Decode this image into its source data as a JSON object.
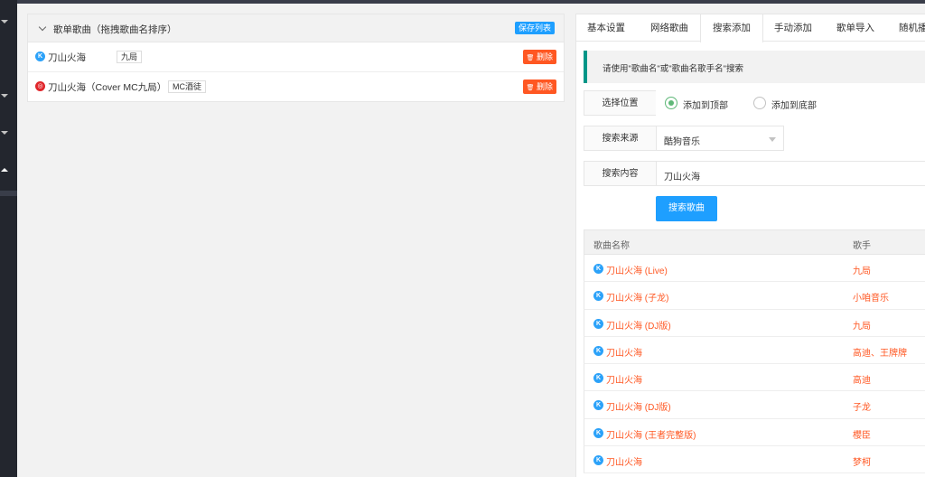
{
  "playlist": {
    "title": "歌单歌曲（拖拽歌曲名排序）",
    "save_label": "保存列表",
    "songs": [
      {
        "name": "刀山火海",
        "tag": "九局",
        "source": "kugou",
        "delete_label": "删除"
      },
      {
        "name": "刀山火海（Cover MC九局）",
        "tag": "MC酒徒",
        "source": "netease",
        "delete_label": "删除"
      }
    ]
  },
  "tabs": [
    "基本设置",
    "网络歌曲",
    "搜索添加",
    "手动添加",
    "歌单导入",
    "随机播"
  ],
  "active_tab": "搜索添加",
  "notice": "请使用\"歌曲名\"或\"歌曲名歌手名\"搜索",
  "form": {
    "position_label": "选择位置",
    "position_options": [
      "添加到顶部",
      "添加到底部"
    ],
    "position_selected": "添加到顶部",
    "source_label": "搜索来源",
    "source_value": "酷狗音乐",
    "content_label": "搜索内容",
    "content_value": "刀山火海",
    "search_button": "搜索歌曲"
  },
  "results": {
    "headers": [
      "歌曲名称",
      "歌手"
    ],
    "rows": [
      {
        "name": "刀山火海 (Live)",
        "singer": "九局"
      },
      {
        "name": "刀山火海 (子龙)",
        "singer": "小咱音乐"
      },
      {
        "name": "刀山火海 (DJ版)",
        "singer": "九局"
      },
      {
        "name": "刀山火海",
        "singer": "高迪、王牌牌"
      },
      {
        "name": "刀山火海",
        "singer": "高迪"
      },
      {
        "name": "刀山火海 (DJ版)",
        "singer": "子龙"
      },
      {
        "name": "刀山火海 (王者完整版)",
        "singer": "櫻臣"
      },
      {
        "name": "刀山火海",
        "singer": "梦柯"
      }
    ]
  },
  "icons": {
    "kugou": "K",
    "netease": "◎",
    "trash": "🗑"
  },
  "colors": {
    "accent": "#1e9fff",
    "danger": "#ff5722",
    "success": "#5fb878",
    "notice_border": "#009688",
    "sidebar": "#23262e"
  }
}
